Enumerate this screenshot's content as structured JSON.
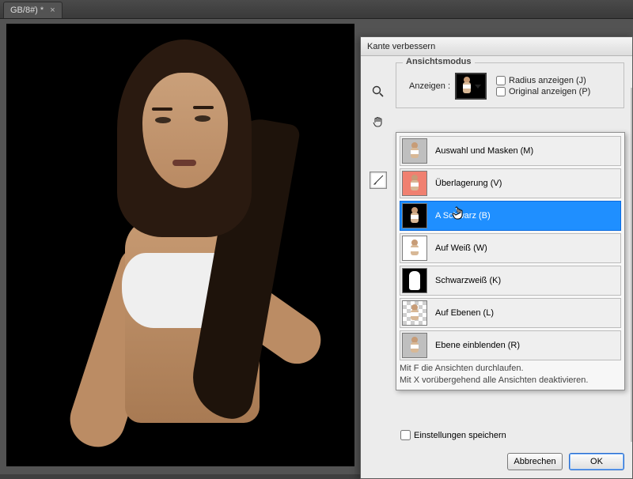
{
  "tab": {
    "title": "GB/8#) *",
    "close": "×"
  },
  "dialog": {
    "title": "Kante verbessern",
    "fieldset_label": "Ansichtsmodus",
    "show_label": "Anzeigen :",
    "checkboxes": {
      "radius": "Radius anzeigen (J)",
      "original": "Original anzeigen (P)"
    },
    "dropdown": {
      "items": [
        {
          "label": "Auswahl und Masken (M)",
          "key": "M",
          "thumb": "gray"
        },
        {
          "label": "Überlagerung (V)",
          "key": "V",
          "thumb": "red"
        },
        {
          "label": "Schwarz (B)",
          "key": "B",
          "thumb": "black",
          "selected": true,
          "prefix": "A"
        },
        {
          "label": "Auf Weiß (W)",
          "key": "W",
          "thumb": "white"
        },
        {
          "label": "Schwarzweiß (K)",
          "key": "K",
          "thumb": "bw"
        },
        {
          "label": "Auf Ebenen (L)",
          "key": "L",
          "thumb": "chk"
        },
        {
          "label": "Ebene einblenden (R)",
          "key": "R",
          "thumb": "gray"
        }
      ],
      "hint1": "Mit F die Ansichten durchlaufen.",
      "hint2": "Mit X vorübergehend alle Ansichten deaktivieren."
    },
    "save_settings": "Einstellungen speichern",
    "buttons": {
      "cancel": "Abbrechen",
      "ok": "OK"
    },
    "tools": {
      "zoom": "zoom",
      "hand": "hand",
      "brush": "brush"
    }
  }
}
